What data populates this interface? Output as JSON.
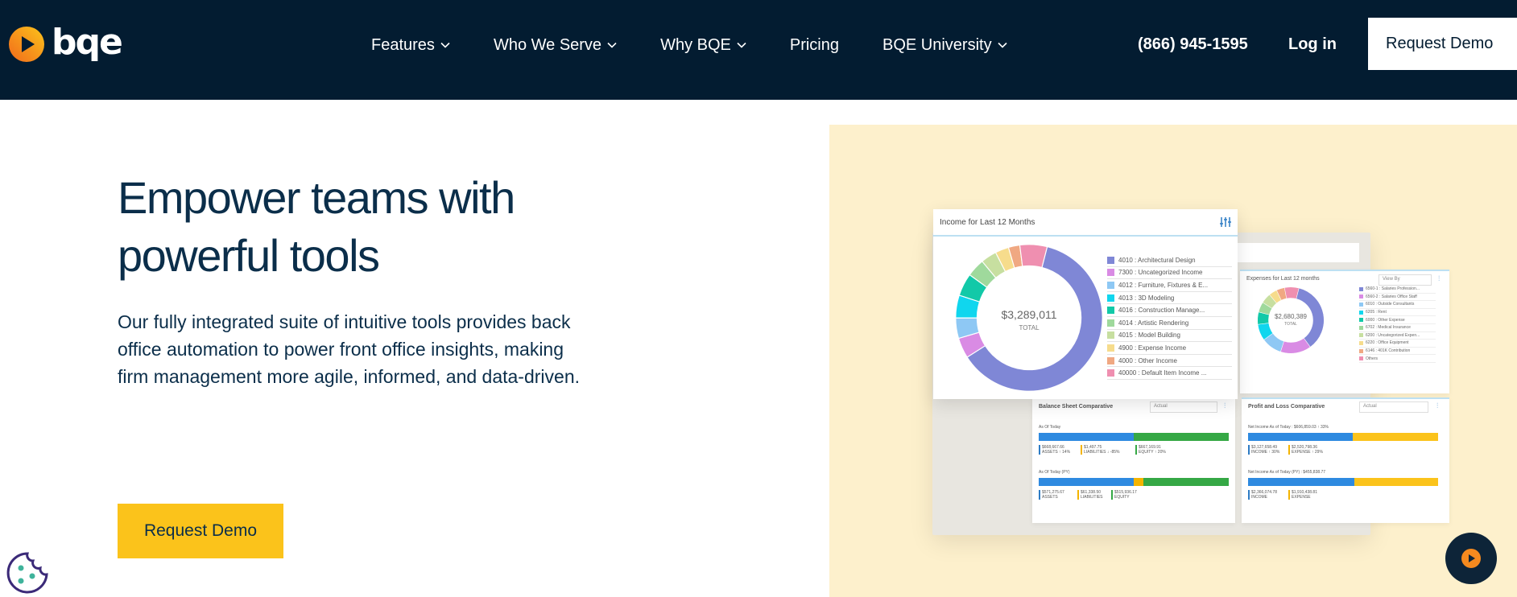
{
  "header": {
    "logo_text": "bqe",
    "nav": [
      {
        "label": "Features",
        "dropdown": true
      },
      {
        "label": "Who We Serve",
        "dropdown": true
      },
      {
        "label": "Why BQE",
        "dropdown": true
      },
      {
        "label": "Pricing",
        "dropdown": false
      },
      {
        "label": "BQE University",
        "dropdown": true
      }
    ],
    "phone": "(866) 945-1595",
    "login": "Log in",
    "demo_label": "Request Demo"
  },
  "hero": {
    "title_line1": "Empower teams with",
    "title_line2": "powerful tools",
    "body": "Our fully integrated suite of intuitive tools provides back office automation to power front office insights, making firm management more agile, informed, and data-driven.",
    "cta_label": "Request Demo"
  },
  "dashboard": {
    "income": {
      "title": "Income for Last 12 Months",
      "total_value": "$3,289,011",
      "total_label": "TOTAL",
      "legend": [
        {
          "label": "4010 : Architectural Design",
          "color": "#7f87d6"
        },
        {
          "label": "7300 : Uncategorized Income",
          "color": "#d98be4"
        },
        {
          "label": "4012 : Furniture, Fixtures & E...",
          "color": "#8ec8f4"
        },
        {
          "label": "4013 : 3D Modeling",
          "color": "#10d6ee"
        },
        {
          "label": "4016 : Construction Manage...",
          "color": "#12c9a8"
        },
        {
          "label": "4014 : Artistic Rendering",
          "color": "#9fd99c"
        },
        {
          "label": "4015 : Model Building",
          "color": "#c7dfa0"
        },
        {
          "label": "4900 : Expense Income",
          "color": "#f6dc8c"
        },
        {
          "label": "4000 : Other Income",
          "color": "#f0a882"
        },
        {
          "label": "40000 : Default Item Income ...",
          "color": "#ef8fb0"
        }
      ]
    },
    "expenses": {
      "title": "Expenses for Last 12 months",
      "view": "View By",
      "total_value": "$2,680,389",
      "total_label": "TOTAL",
      "legend": [
        {
          "label": "6560-1 : Salaries Profession...",
          "color": "#7f87d6"
        },
        {
          "label": "6560-2 : Salaries Office Staff",
          "color": "#d98be4"
        },
        {
          "label": "6010 : Outside Consultants",
          "color": "#8ec8f4"
        },
        {
          "label": "6205 : Rent",
          "color": "#10d6ee"
        },
        {
          "label": "6000 : Other Expense",
          "color": "#12c9a8"
        },
        {
          "label": "6702 : Medical Insurance",
          "color": "#9fd99c"
        },
        {
          "label": "6200 : Uncategorized Expen...",
          "color": "#c7dfa0"
        },
        {
          "label": "6220 : Office Equipment",
          "color": "#f6dc8c"
        },
        {
          "label": "6146 : 401K Contribution",
          "color": "#f0a882"
        },
        {
          "label": "Others",
          "color": "#ef8fb0"
        }
      ]
    },
    "balance": {
      "title": "Balance Sheet  Comparative",
      "select": "Actual",
      "as_of_today": "As Of Today",
      "as_of_py": "As Of Today (PY)",
      "figures_today": [
        {
          "value": "$668,667.66",
          "label": "ASSETS  ↑ 14%"
        },
        {
          "value": "$1,497.75",
          "label": "LIABILITIES  ↓ -85%"
        },
        {
          "value": "$667,169.91",
          "label": "EQUITY  ↑ 20%"
        }
      ],
      "figures_py": [
        {
          "value": "$571,275.67",
          "label": "ASSETS"
        },
        {
          "value": "$61,338.50",
          "label": "LIABILITIES"
        },
        {
          "value": "$515,936.17",
          "label": "EQUITY"
        }
      ]
    },
    "pl": {
      "title": "Profit and Loss Comparative",
      "select": "Actual",
      "net_today": "Net Income As of Today : $606,859.03  ↑ 33%",
      "net_py": "Net Income As of Today (PY) : $455,838.77",
      "figures_today": [
        {
          "value": "$3,127,658.49",
          "label": "INCOME  ↑ 30%"
        },
        {
          "value": "$2,520,798.36",
          "label": "EXPENSE  ↑ 29%"
        }
      ],
      "figures_py": [
        {
          "value": "$2,366,074.78",
          "label": "INCOME"
        },
        {
          "value": "$1,910,438.81",
          "label": "EXPENSE"
        }
      ]
    }
  },
  "colors": {
    "header_bg": "#031c31",
    "accent_yellow": "#fbc31b",
    "hero_panel_bg": "#fdf0cc",
    "text_navy": "#0b2e4a"
  }
}
